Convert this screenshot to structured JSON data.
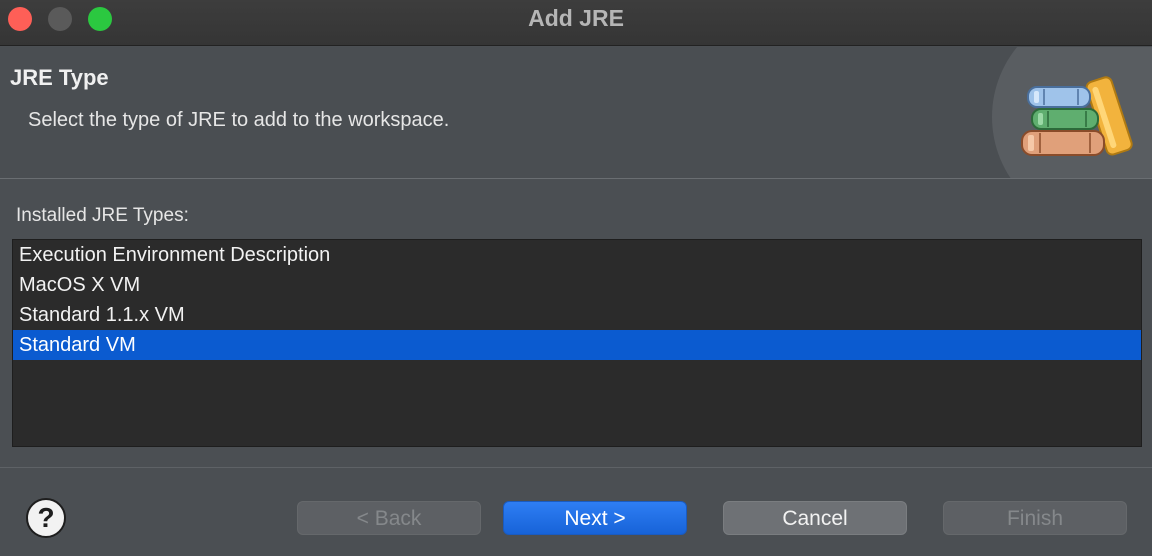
{
  "window": {
    "title": "Add JRE"
  },
  "banner": {
    "title": "JRE Type",
    "description": "Select the type of JRE to add to the workspace.",
    "icon": "books-icon"
  },
  "list": {
    "label": "Installed JRE Types:",
    "items": [
      {
        "label": "Execution Environment Description",
        "selected": false
      },
      {
        "label": "MacOS X VM",
        "selected": false
      },
      {
        "label": "Standard 1.1.x VM",
        "selected": false
      },
      {
        "label": "Standard VM",
        "selected": true
      }
    ]
  },
  "buttons": {
    "help": "?",
    "back": "< Back",
    "next": "Next >",
    "cancel": "Cancel",
    "finish": "Finish"
  },
  "colors": {
    "selection": "#0b5bd0",
    "primary_button": "#1763d8",
    "close": "#fe5f57",
    "maximize": "#2bc840"
  }
}
